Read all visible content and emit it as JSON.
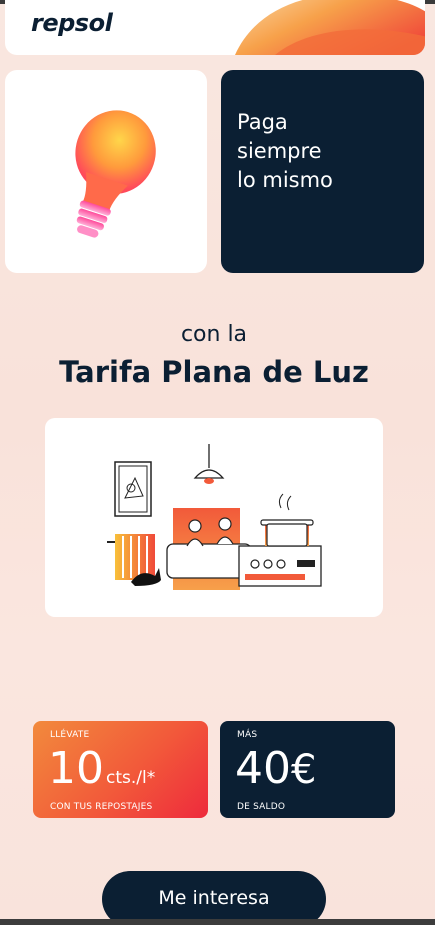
{
  "header": {
    "logo_text": "repsol"
  },
  "hero": {
    "bulb_icon": "lightbulb-illustration",
    "headline_lines": [
      "Paga",
      "siempre",
      "lo mismo"
    ]
  },
  "intro": {
    "subtitle": "con la",
    "title": "Tarifa Plana de Luz"
  },
  "illustration": {
    "icon": "home-kitchen-illustration"
  },
  "promos": [
    {
      "kicker": "LLÉVATE",
      "value": "10",
      "unit": "cts./l*",
      "footer": "CON TUS REPOSTAJES"
    },
    {
      "kicker": "MÁS",
      "value": "40",
      "unit": "€",
      "footer": "DE SALDO"
    }
  ],
  "cta": {
    "label": "Me interesa"
  },
  "colors": {
    "navy": "#0b1f33",
    "orange": "#f28a3c",
    "red": "#ee2a3c",
    "background": "#f9e4dc"
  }
}
